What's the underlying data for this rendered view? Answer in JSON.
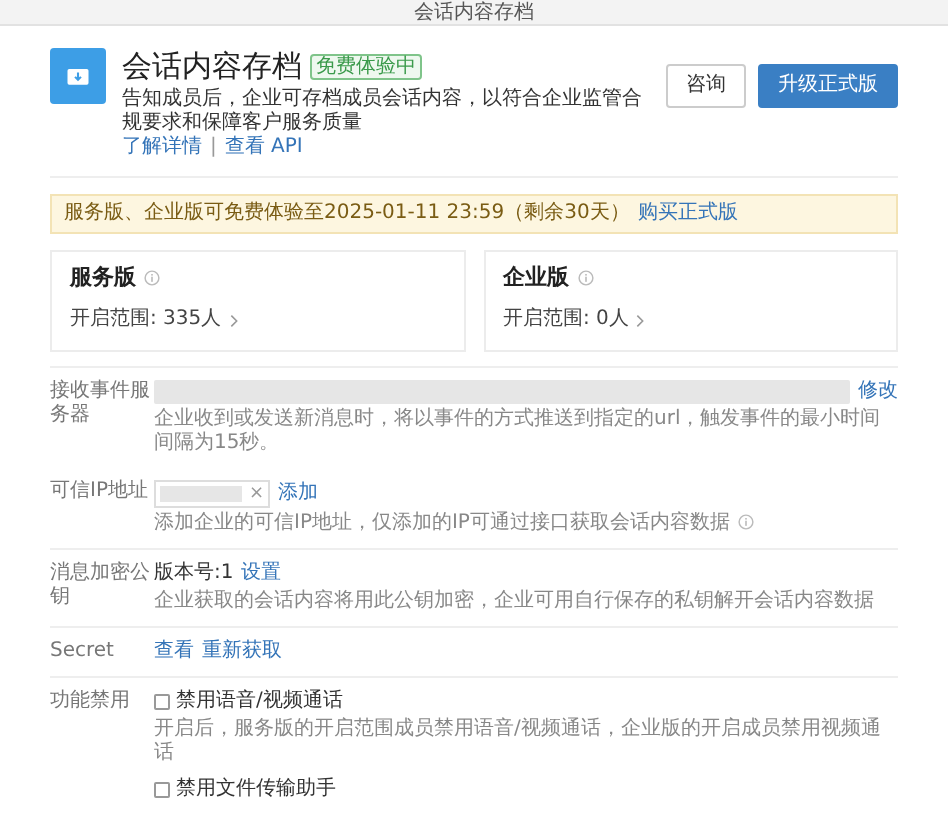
{
  "window": {
    "title": "会话内容存档"
  },
  "app": {
    "name": "会话内容存档",
    "badge": "免费体验中",
    "description": "告知成员后，企业可存档成员会话内容，以符合企业监管合规要求和保障客户服务质量",
    "links": [
      "了解详情",
      "查看 API"
    ],
    "separator": "|",
    "buttons": [
      {
        "label": "咨询",
        "kind": "default"
      },
      {
        "label": "升级正式版",
        "kind": "primary"
      }
    ]
  },
  "notice": {
    "text": "服务版、企业版可免费体验至2025-01-11 23:59（剩余30天）",
    "link": "购买正式版"
  },
  "editions": [
    {
      "name": "服务版",
      "scope": "开启范围: 335人"
    },
    {
      "name": "企业版",
      "scope": "开启范围: 0人"
    }
  ],
  "settings": [
    {
      "kind": "server",
      "label": "接收事件服务器",
      "action": "修改",
      "hint": "企业收到或发送新消息时，将以事件的方式推送到指定的url，触发事件的最小时间间隔为15秒。"
    },
    {
      "kind": "ip",
      "label": "可信IP地址",
      "remove": "×",
      "action": "添加",
      "hint": "添加企业的可信IP地址，仅添加的IP可通过接口获取会话内容数据"
    },
    {
      "kind": "key",
      "label": "消息加密公钥",
      "value": "版本号:1",
      "action": "设置",
      "hint": "企业获取的会话内容将用此公钥加密，企业可用自行保存的私钥解开会话内容数据"
    },
    {
      "kind": "secret",
      "label": "Secret",
      "actions": [
        "查看",
        "重新获取"
      ]
    },
    {
      "kind": "toggles",
      "label": "功能禁用",
      "options": [
        {
          "label": "禁用语音/视频通话",
          "checked": false,
          "hint": "开启后，服务版的开启范围成员禁用语音/视频通话，企业版的开启成员禁用视频通话"
        },
        {
          "label": "禁用文件传输助手",
          "checked": false
        }
      ]
    }
  ]
}
